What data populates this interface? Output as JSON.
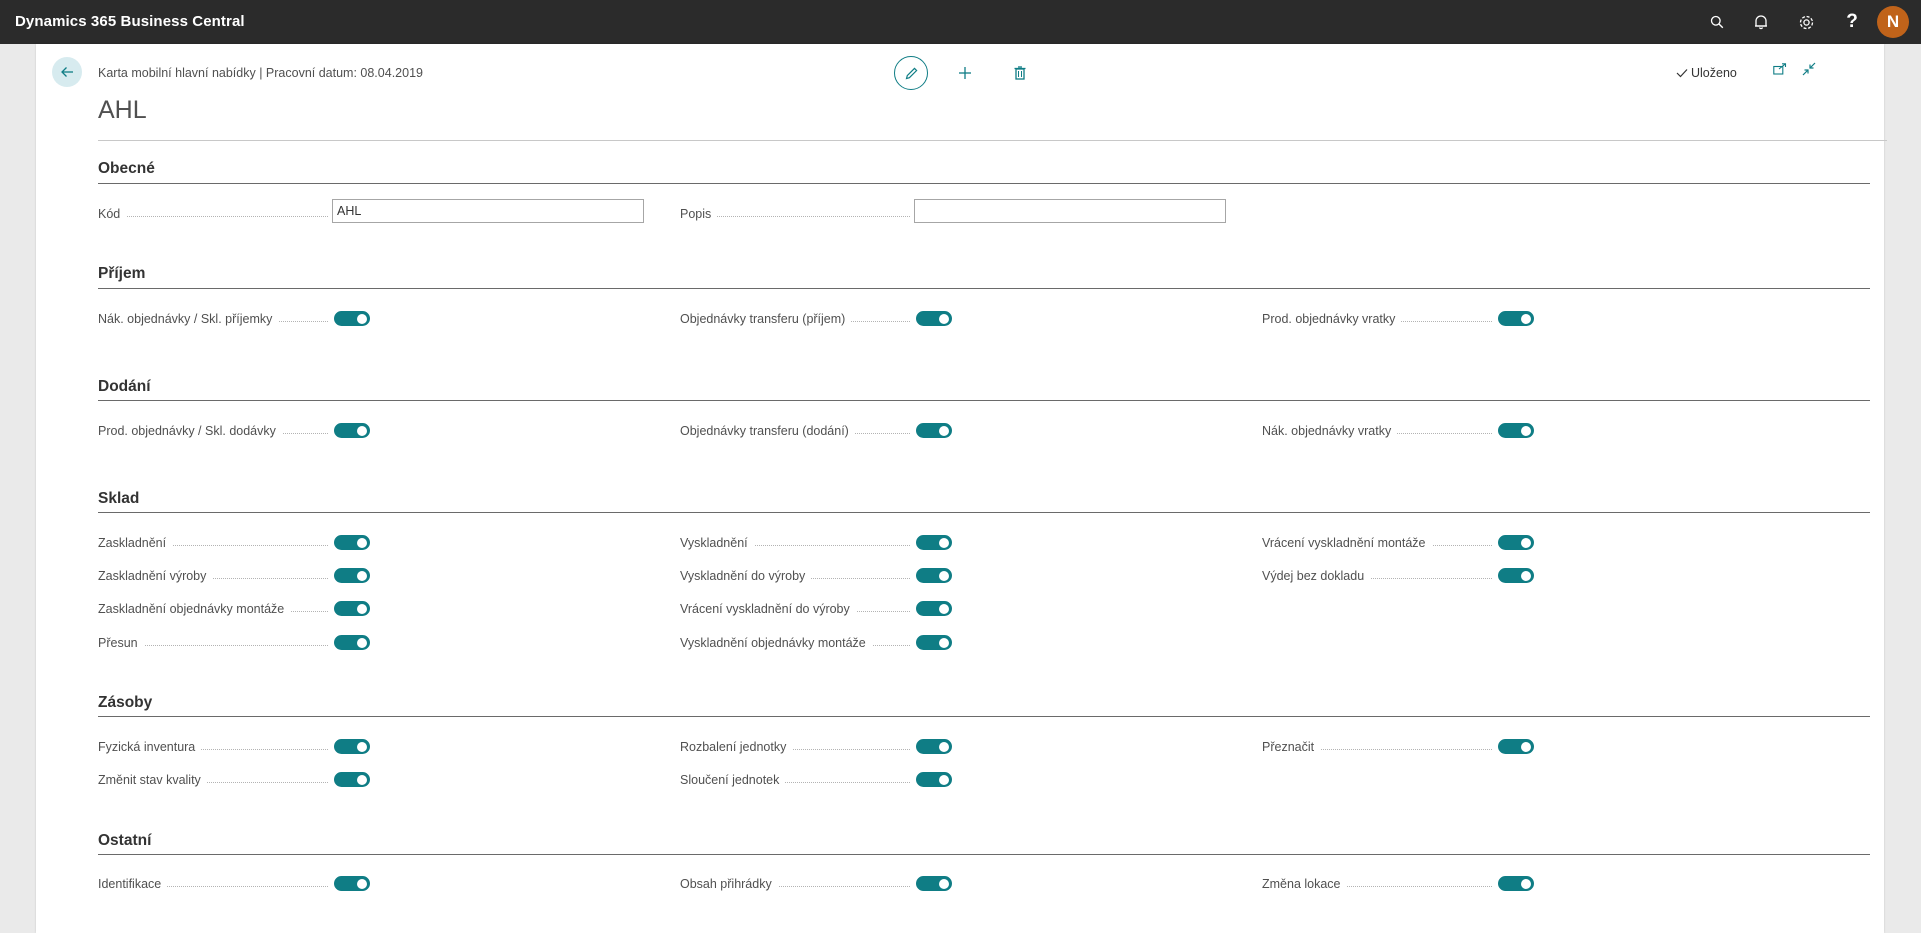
{
  "app": {
    "title": "Dynamics 365 Business Central",
    "user_initial": "N",
    "help_glyph": "?"
  },
  "page": {
    "caption": "Karta mobilní hlavní nabídky | Pracovní datum: 08.04.2019",
    "title": "AHL",
    "status": "Uloženo"
  },
  "general": {
    "title": "Obecné",
    "code_label": "Kód",
    "code_value": "AHL",
    "desc_label": "Popis",
    "desc_value": ""
  },
  "receipt": {
    "title": "Příjem",
    "items": [
      {
        "label": "Nák. objednávky / Skl. příjemky",
        "on": true
      },
      {
        "label": "Objednávky transferu (příjem)",
        "on": true
      },
      {
        "label": "Prod. objednávky vratky",
        "on": true
      }
    ]
  },
  "shipment": {
    "title": "Dodání",
    "items": [
      {
        "label": "Prod. objednávky / Skl. dodávky",
        "on": true
      },
      {
        "label": "Objednávky transferu (dodání)",
        "on": true
      },
      {
        "label": "Nák. objednávky vratky",
        "on": true
      }
    ]
  },
  "warehouse": {
    "title": "Sklad",
    "items": [
      {
        "label": "Zaskladnění",
        "on": true
      },
      {
        "label": "Zaskladnění výroby",
        "on": true
      },
      {
        "label": "Zaskladnění objednávky montáže",
        "on": true
      },
      {
        "label": "Přesun",
        "on": true
      },
      {
        "label": "Vyskladnění",
        "on": true
      },
      {
        "label": "Vyskladnění do výroby",
        "on": true
      },
      {
        "label": "Vrácení vyskladnění do výroby",
        "on": true
      },
      {
        "label": "Vyskladnění objednávky montáže",
        "on": true
      },
      {
        "label": "Vrácení vyskladnění montáže",
        "on": true
      },
      {
        "label": "Výdej bez dokladu",
        "on": true
      }
    ]
  },
  "inventory": {
    "title": "Zásoby",
    "items": [
      {
        "label": "Fyzická inventura",
        "on": true
      },
      {
        "label": "Změnit stav kvality",
        "on": true
      },
      {
        "label": "Rozbalení jednotky",
        "on": true
      },
      {
        "label": "Sloučení jednotek",
        "on": true
      },
      {
        "label": "Přeznačit",
        "on": true
      }
    ]
  },
  "other": {
    "title": "Ostatní",
    "items": [
      {
        "label": "Identifikace",
        "on": true
      },
      {
        "label": "Obsah přihrádky",
        "on": true
      },
      {
        "label": "Změna lokace",
        "on": true
      }
    ]
  },
  "icons": {
    "search": "search-icon",
    "bell": "bell-icon",
    "gear": "gear-icon",
    "help": "help-icon",
    "back": "back-arrow-icon",
    "edit": "pencil-icon",
    "new": "plus-icon",
    "delete": "trash-icon",
    "saved": "checkmark-icon",
    "share": "open-in-new-window-icon",
    "collapse": "collapse-icon"
  },
  "colors": {
    "accent": "#0f7d85",
    "topbar": "#2b2b2b",
    "avatar": "#c0631a"
  }
}
